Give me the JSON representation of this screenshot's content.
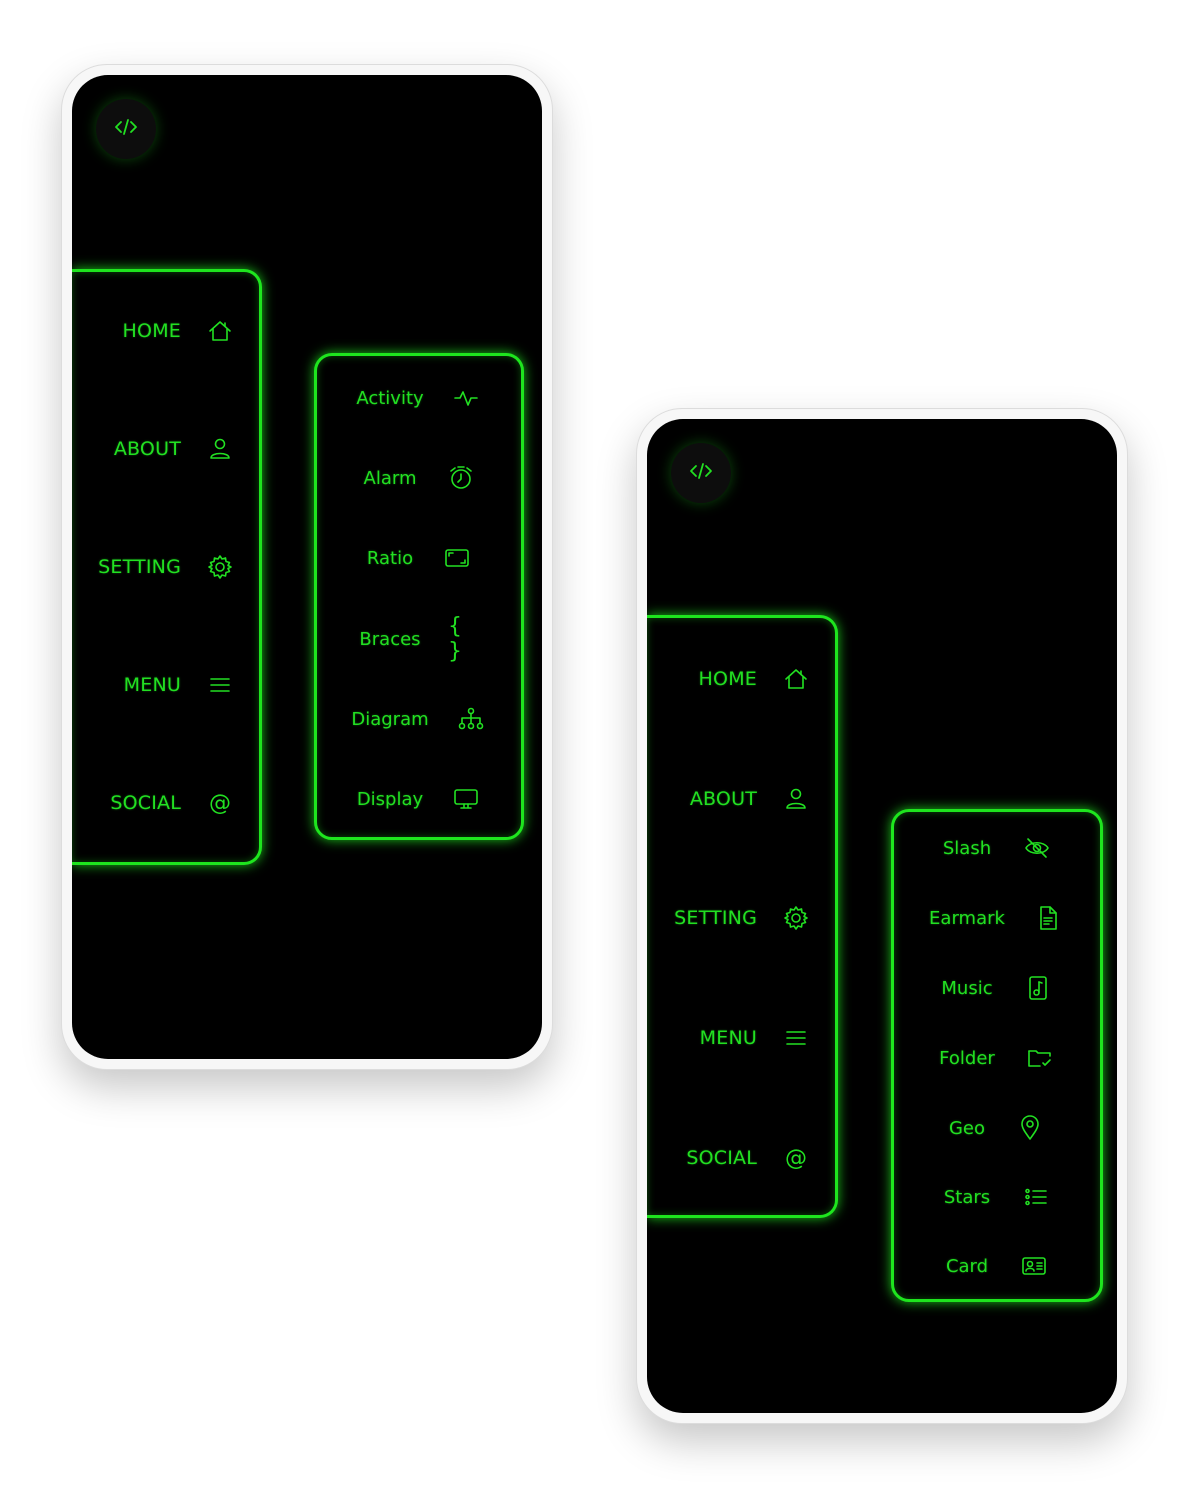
{
  "accent_color": "#22e022",
  "logo": {
    "icon": "code-icon"
  },
  "main_menu": [
    {
      "label": "HOME",
      "icon": "home-icon"
    },
    {
      "label": "ABOUT",
      "icon": "user-icon"
    },
    {
      "label": "SETTING",
      "icon": "gear-icon"
    },
    {
      "label": "MENU",
      "icon": "list-icon"
    },
    {
      "label": "SOCIAL",
      "icon": "at-icon"
    }
  ],
  "left_submenu": [
    {
      "label": "Activity",
      "icon": "activity-icon"
    },
    {
      "label": "Alarm",
      "icon": "alarm-icon"
    },
    {
      "label": "Ratio",
      "icon": "aspect-ratio-icon"
    },
    {
      "label": "Braces",
      "icon": "braces-icon"
    },
    {
      "label": "Diagram",
      "icon": "diagram-icon"
    },
    {
      "label": "Display",
      "icon": "display-icon"
    }
  ],
  "right_submenu": [
    {
      "label": "Slash",
      "icon": "eye-slash-icon"
    },
    {
      "label": "Earmark",
      "icon": "file-earmark-icon"
    },
    {
      "label": "Music",
      "icon": "music-file-icon"
    },
    {
      "label": "Folder",
      "icon": "folder-check-icon"
    },
    {
      "label": "Geo",
      "icon": "geo-pin-icon"
    },
    {
      "label": "Stars",
      "icon": "star-list-icon"
    },
    {
      "label": "Card",
      "icon": "person-card-icon"
    }
  ]
}
